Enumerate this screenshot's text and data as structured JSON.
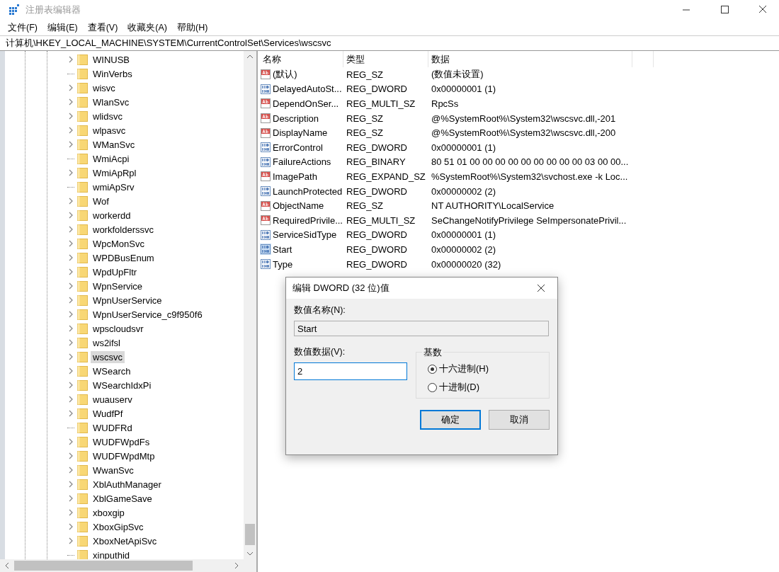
{
  "window": {
    "title": "注册表编辑器"
  },
  "menu": [
    "文件(F)",
    "编辑(E)",
    "查看(V)",
    "收藏夹(A)",
    "帮助(H)"
  ],
  "address": "计算机\\HKEY_LOCAL_MACHINE\\SYSTEM\\CurrentControlSet\\Services\\wscsvc",
  "tree": [
    {
      "label": "WINUSB",
      "expandable": true,
      "selected": false
    },
    {
      "label": "WinVerbs",
      "expandable": false,
      "selected": false
    },
    {
      "label": "wisvc",
      "expandable": true,
      "selected": false
    },
    {
      "label": "WlanSvc",
      "expandable": true,
      "selected": false
    },
    {
      "label": "wlidsvc",
      "expandable": true,
      "selected": false
    },
    {
      "label": "wlpasvc",
      "expandable": true,
      "selected": false
    },
    {
      "label": "WManSvc",
      "expandable": true,
      "selected": false
    },
    {
      "label": "WmiAcpi",
      "expandable": false,
      "selected": false
    },
    {
      "label": "WmiApRpl",
      "expandable": true,
      "selected": false
    },
    {
      "label": "wmiApSrv",
      "expandable": false,
      "selected": false
    },
    {
      "label": "Wof",
      "expandable": true,
      "selected": false
    },
    {
      "label": "workerdd",
      "expandable": true,
      "selected": false
    },
    {
      "label": "workfolderssvc",
      "expandable": true,
      "selected": false
    },
    {
      "label": "WpcMonSvc",
      "expandable": true,
      "selected": false
    },
    {
      "label": "WPDBusEnum",
      "expandable": true,
      "selected": false
    },
    {
      "label": "WpdUpFltr",
      "expandable": true,
      "selected": false
    },
    {
      "label": "WpnService",
      "expandable": true,
      "selected": false
    },
    {
      "label": "WpnUserService",
      "expandable": true,
      "selected": false
    },
    {
      "label": "WpnUserService_c9f950f6",
      "expandable": true,
      "selected": false
    },
    {
      "label": "wpscloudsvr",
      "expandable": true,
      "selected": false
    },
    {
      "label": "ws2ifsl",
      "expandable": true,
      "selected": false
    },
    {
      "label": "wscsvc",
      "expandable": true,
      "selected": true
    },
    {
      "label": "WSearch",
      "expandable": true,
      "selected": false
    },
    {
      "label": "WSearchIdxPi",
      "expandable": true,
      "selected": false
    },
    {
      "label": "wuauserv",
      "expandable": true,
      "selected": false
    },
    {
      "label": "WudfPf",
      "expandable": true,
      "selected": false
    },
    {
      "label": "WUDFRd",
      "expandable": false,
      "selected": false
    },
    {
      "label": "WUDFWpdFs",
      "expandable": true,
      "selected": false
    },
    {
      "label": "WUDFWpdMtp",
      "expandable": true,
      "selected": false
    },
    {
      "label": "WwanSvc",
      "expandable": true,
      "selected": false
    },
    {
      "label": "XblAuthManager",
      "expandable": true,
      "selected": false
    },
    {
      "label": "XblGameSave",
      "expandable": true,
      "selected": false
    },
    {
      "label": "xboxgip",
      "expandable": true,
      "selected": false
    },
    {
      "label": "XboxGipSvc",
      "expandable": true,
      "selected": false
    },
    {
      "label": "XboxNetApiSvc",
      "expandable": true,
      "selected": false
    },
    {
      "label": "xinputhid",
      "expandable": false,
      "selected": false
    }
  ],
  "values": {
    "columns": [
      "名称",
      "类型",
      "数据"
    ],
    "rows": [
      {
        "kind": "string",
        "name": "(默认)",
        "type": "REG_SZ",
        "data": "(数值未设置)",
        "selected": false
      },
      {
        "kind": "binary",
        "name": "DelayedAutoSt...",
        "type": "REG_DWORD",
        "data": "0x00000001 (1)",
        "selected": false
      },
      {
        "kind": "string",
        "name": "DependOnSer...",
        "type": "REG_MULTI_SZ",
        "data": "RpcSs",
        "selected": false
      },
      {
        "kind": "string",
        "name": "Description",
        "type": "REG_SZ",
        "data": "@%SystemRoot%\\System32\\wscsvc.dll,-201",
        "selected": false
      },
      {
        "kind": "string",
        "name": "DisplayName",
        "type": "REG_SZ",
        "data": "@%SystemRoot%\\System32\\wscsvc.dll,-200",
        "selected": false
      },
      {
        "kind": "binary",
        "name": "ErrorControl",
        "type": "REG_DWORD",
        "data": "0x00000001 (1)",
        "selected": false
      },
      {
        "kind": "binary",
        "name": "FailureActions",
        "type": "REG_BINARY",
        "data": "80 51 01 00 00 00 00 00 00 00 00 00 03 00 00...",
        "selected": false
      },
      {
        "kind": "string",
        "name": "ImagePath",
        "type": "REG_EXPAND_SZ",
        "data": "%SystemRoot%\\System32\\svchost.exe -k Loc...",
        "selected": false
      },
      {
        "kind": "binary",
        "name": "LaunchProtected",
        "type": "REG_DWORD",
        "data": "0x00000002 (2)",
        "selected": false
      },
      {
        "kind": "string",
        "name": "ObjectName",
        "type": "REG_SZ",
        "data": "NT AUTHORITY\\LocalService",
        "selected": false
      },
      {
        "kind": "string",
        "name": "RequiredPrivile...",
        "type": "REG_MULTI_SZ",
        "data": "SeChangeNotifyPrivilege SeImpersonatePrivil...",
        "selected": false
      },
      {
        "kind": "binary",
        "name": "ServiceSidType",
        "type": "REG_DWORD",
        "data": "0x00000001 (1)",
        "selected": false
      },
      {
        "kind": "binary",
        "name": "Start",
        "type": "REG_DWORD",
        "data": "0x00000002 (2)",
        "selected": true
      },
      {
        "kind": "binary",
        "name": "Type",
        "type": "REG_DWORD",
        "data": "0x00000020 (32)",
        "selected": false
      }
    ]
  },
  "dialog": {
    "title": "编辑 DWORD (32 位)值",
    "name_label": "数值名称(N):",
    "name_value": "Start",
    "data_label": "数值数据(V):",
    "data_value": "2",
    "base_label": "基数",
    "radios": [
      {
        "label": "十六进制(H)",
        "selected": true
      },
      {
        "label": "十进制(D)",
        "selected": false
      }
    ],
    "buttons": [
      {
        "label": "确定",
        "default": true
      },
      {
        "label": "取消",
        "default": false
      }
    ]
  }
}
